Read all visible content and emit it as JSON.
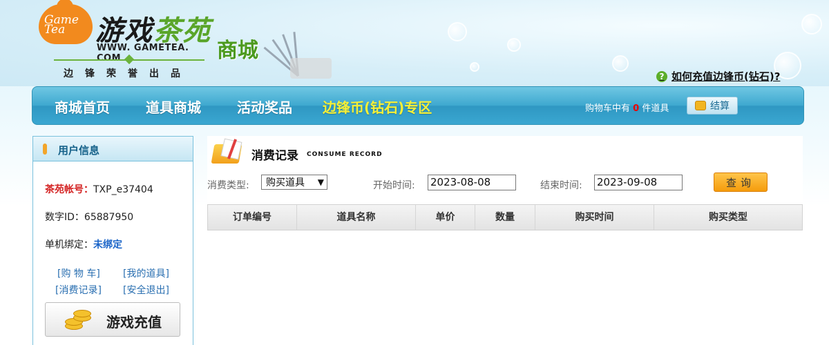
{
  "header": {
    "logo_pot_text": "Game Tea",
    "logo_title_a": "游戏",
    "logo_title_b": "茶苑",
    "logo_url": "WWW. GAMETEA. COM",
    "logo_sub": "边锋荣誉出品",
    "mall_label": "商城",
    "help_link": "如何充值边锋币(钻石)?",
    "help_icon": "?"
  },
  "nav": {
    "items": [
      "商城首页",
      "道具商城",
      "活动奖品",
      "边锋币(钻石)专区"
    ],
    "active_index": 3,
    "cart_prefix": "购物车中有",
    "cart_count": "0",
    "cart_suffix": "件道具",
    "checkout_label": "结算"
  },
  "sidebar": {
    "title": "用户信息",
    "account_label": "茶苑帐号：",
    "account_value": "TXP_e37404",
    "id_label": "数字ID：",
    "id_value": "65887950",
    "bind_label": "单机绑定：",
    "bind_value": "未绑定",
    "links": [
      "[购 物 车]",
      "[我的道具]",
      "[消费记录]",
      "[安全退出]"
    ],
    "recharge_label": "游戏充值"
  },
  "main": {
    "section_title": "消费记录",
    "section_subtitle": "CONSUME RECORD",
    "type_label": "消费类型:",
    "type_value": "购买道具",
    "start_label": "开始时间:",
    "start_value": "2023-08-08",
    "end_label": "结束时间:",
    "end_value": "2023-09-08",
    "query_label": "查询",
    "columns": [
      "订单编号",
      "道具名称",
      "单价",
      "数量",
      "购买时间",
      "购买类型"
    ]
  },
  "colors": {
    "nav_blue": "#3ea8cf",
    "nav_active": "#f6f037",
    "query_orange": "#f59c0c",
    "link_blue": "#2a6fb1",
    "label_red": "#d42424"
  }
}
